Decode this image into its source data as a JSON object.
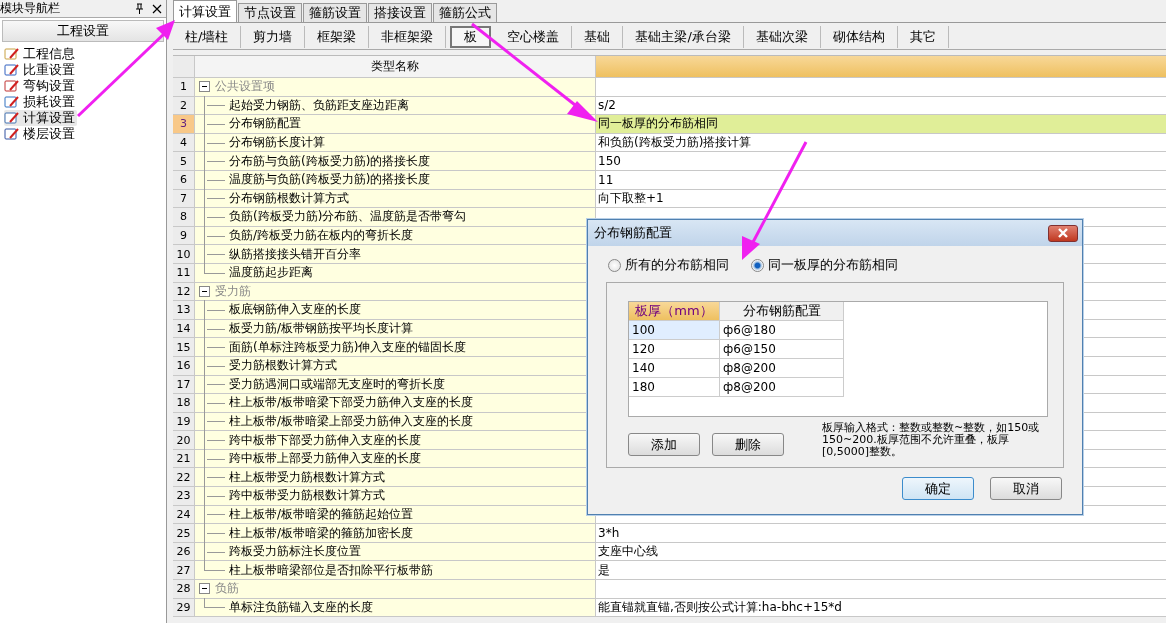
{
  "sidebar": {
    "title": "模块导航栏",
    "header": "工程设置",
    "items": [
      {
        "label": "工程信息",
        "selected": false
      },
      {
        "label": "比重设置",
        "selected": false
      },
      {
        "label": "弯钩设置",
        "selected": false
      },
      {
        "label": "损耗设置",
        "selected": false
      },
      {
        "label": "计算设置",
        "selected": true
      },
      {
        "label": "楼层设置",
        "selected": false
      }
    ]
  },
  "tabs": [
    {
      "label": "计算设置",
      "selected": true
    },
    {
      "label": "节点设置",
      "selected": false
    },
    {
      "label": "箍筋设置",
      "selected": false
    },
    {
      "label": "搭接设置",
      "selected": false
    },
    {
      "label": "箍筋公式",
      "selected": false
    }
  ],
  "subtabs": [
    {
      "label": "柱/墙柱",
      "selected": false
    },
    {
      "label": "剪力墙",
      "selected": false
    },
    {
      "label": "框架梁",
      "selected": false
    },
    {
      "label": "非框架梁",
      "selected": false
    },
    {
      "label": "板",
      "selected": true
    },
    {
      "label": "空心楼盖",
      "selected": false
    },
    {
      "label": "基础",
      "selected": false
    },
    {
      "label": "基础主梁/承台梁",
      "selected": false
    },
    {
      "label": "基础次梁",
      "selected": false
    },
    {
      "label": "砌体结构",
      "selected": false
    },
    {
      "label": "其它",
      "selected": false
    }
  ],
  "table": {
    "columns": [
      "类型名称"
    ],
    "groups": [
      {
        "num": "1",
        "label": "公共设置项",
        "expanded": true,
        "children": [
          {
            "num": "2",
            "name": "起始受力钢筋、负筋距支座边距离",
            "value": "s/2",
            "selected": false
          },
          {
            "num": "3",
            "name": "分布钢筋配置",
            "value": "同一板厚的分布筋相同",
            "selected": true
          },
          {
            "num": "4",
            "name": "分布钢筋长度计算",
            "value": "和负筋(跨板受力筋)搭接计算",
            "selected": false
          },
          {
            "num": "5",
            "name": "分布筋与负筋(跨板受力筋)的搭接长度",
            "value": "150",
            "selected": false
          },
          {
            "num": "6",
            "name": "温度筋与负筋(跨板受力筋)的搭接长度",
            "value": "11",
            "selected": false
          },
          {
            "num": "7",
            "name": "分布钢筋根数计算方式",
            "value": "向下取整+1",
            "selected": false
          },
          {
            "num": "8",
            "name": "负筋(跨板受力筋)分布筋、温度筋是否带弯勾",
            "selected": false
          },
          {
            "num": "9",
            "name": "负筋/跨板受力筋在板内的弯折长度",
            "selected": false
          },
          {
            "num": "10",
            "name": "纵筋搭接接头错开百分率",
            "selected": false
          },
          {
            "num": "11",
            "name": "温度筋起步距离",
            "selected": false
          }
        ]
      },
      {
        "num": "12",
        "label": "受力筋",
        "expanded": true,
        "children": [
          {
            "num": "13",
            "name": "板底钢筋伸入支座的长度",
            "selected": false
          },
          {
            "num": "14",
            "name": "板受力筋/板带钢筋按平均长度计算",
            "selected": false
          },
          {
            "num": "15",
            "name": "面筋(单标注跨板受力筋)伸入支座的锚固长度",
            "selected": false
          },
          {
            "num": "16",
            "name": "受力筋根数计算方式",
            "selected": false
          },
          {
            "num": "17",
            "name": "受力筋遇洞口或端部无支座时的弯折长度",
            "selected": false
          },
          {
            "num": "18",
            "name": "柱上板带/板带暗梁下部受力筋伸入支座的长度",
            "selected": false
          },
          {
            "num": "19",
            "name": "柱上板带/板带暗梁上部受力筋伸入支座的长度",
            "selected": false
          },
          {
            "num": "20",
            "name": "跨中板带下部受力筋伸入支座的长度",
            "selected": false
          },
          {
            "num": "21",
            "name": "跨中板带上部受力筋伸入支座的长度",
            "selected": false
          },
          {
            "num": "22",
            "name": "柱上板带受力筋根数计算方式",
            "selected": false
          },
          {
            "num": "23",
            "name": "跨中板带受力筋根数计算方式",
            "selected": false
          },
          {
            "num": "24",
            "name": "柱上板带/板带暗梁的箍筋起始位置",
            "selected": false
          },
          {
            "num": "25",
            "name": "柱上板带/板带暗梁的箍筋加密长度",
            "value": "3*h",
            "selected": false
          },
          {
            "num": "26",
            "name": "跨板受力筋标注长度位置",
            "value": "支座中心线",
            "selected": false
          },
          {
            "num": "27",
            "name": "柱上板带暗梁部位是否扣除平行板带筋",
            "value": "是",
            "selected": false
          }
        ]
      },
      {
        "num": "28",
        "label": "负筋",
        "expanded": true,
        "children": [
          {
            "num": "29",
            "name": "单标注负筋锚入支座的长度",
            "value": "能直锚就直锚,否则按公式计算:ha-bhc+15*d",
            "selected": false
          }
        ]
      }
    ]
  },
  "dialog": {
    "title": "分布钢筋配置",
    "radios": [
      {
        "label": "所有的分布筋相同",
        "selected": false
      },
      {
        "label": "同一板厚的分布筋相同",
        "selected": true
      }
    ],
    "grid": {
      "columns": [
        "板厚（mm）",
        "分布钢筋配置"
      ],
      "rows": [
        {
          "cells": [
            "100",
            "ф6@180"
          ],
          "selected": true
        },
        {
          "cells": [
            "120",
            "ф6@150"
          ],
          "selected": false
        },
        {
          "cells": [
            "140",
            "ф8@200"
          ],
          "selected": false
        },
        {
          "cells": [
            "180",
            "ф8@200"
          ],
          "selected": false
        }
      ]
    },
    "actions": [
      "添加",
      "删除"
    ],
    "note": "板厚输入格式：整数或整数~整数，如150或150~200.板厚范围不允许重叠，板厚[0,5000]整数。",
    "buttons": [
      {
        "label": "确定",
        "default": true
      },
      {
        "label": "取消",
        "default": false
      }
    ]
  }
}
